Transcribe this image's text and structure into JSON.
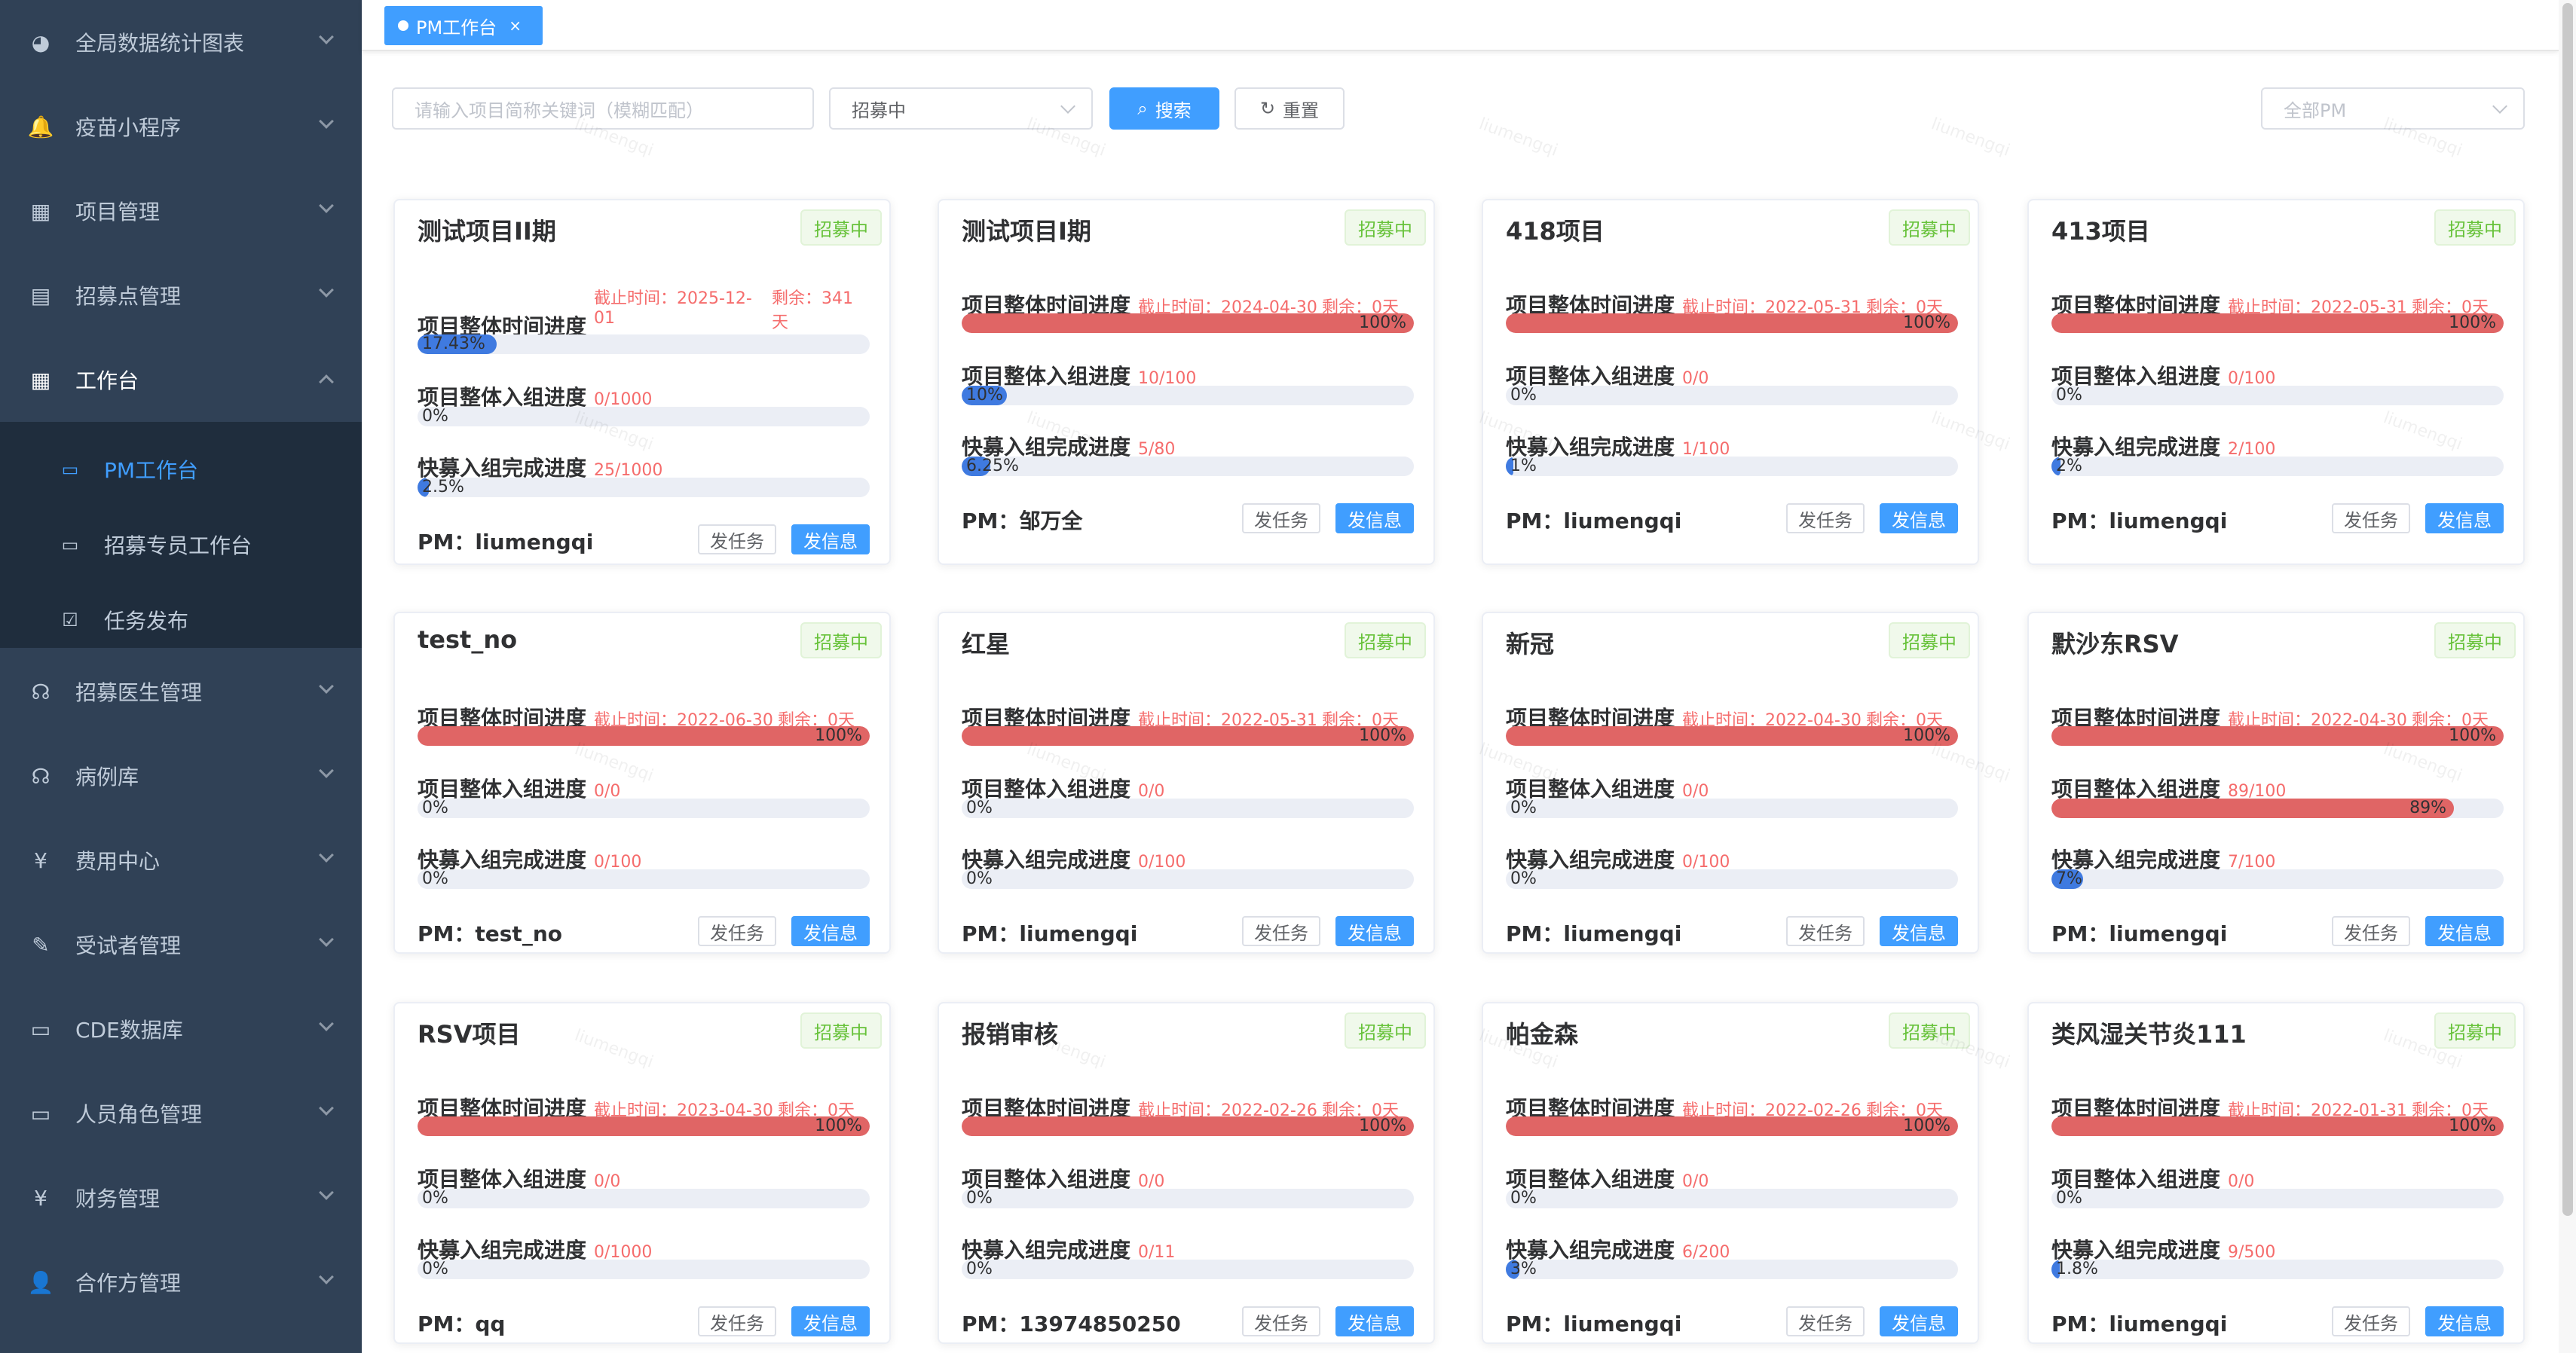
{
  "sidebar": {
    "items": [
      {
        "label": "全局数据统计图表",
        "icon": "dashboard-icon",
        "glyph": "◕"
      },
      {
        "label": "疫苗小程序",
        "icon": "bell-icon",
        "glyph": "🔔"
      },
      {
        "label": "项目管理",
        "icon": "grid-icon",
        "glyph": "▦"
      },
      {
        "label": "招募点管理",
        "icon": "table-icon",
        "glyph": "▤"
      },
      {
        "label": "工作台",
        "icon": "workbench-icon",
        "glyph": "▦"
      },
      {
        "label": "招募医生管理",
        "icon": "doctor-icon",
        "glyph": "☊"
      },
      {
        "label": "病例库",
        "icon": "case-icon",
        "glyph": "☊"
      },
      {
        "label": "费用中心",
        "icon": "yen-icon",
        "glyph": "¥"
      },
      {
        "label": "受试者管理",
        "icon": "subject-icon",
        "glyph": "✎"
      },
      {
        "label": "CDE数据库",
        "icon": "database-icon",
        "glyph": "▭"
      },
      {
        "label": "人员角色管理",
        "icon": "role-icon",
        "glyph": "▭"
      },
      {
        "label": "财务管理",
        "icon": "finance-icon",
        "glyph": "¥"
      },
      {
        "label": "合作方管理",
        "icon": "partner-icon",
        "glyph": "👤"
      }
    ],
    "submenu": [
      {
        "label": "PM工作台",
        "icon": "monitor-icon",
        "glyph": "▭"
      },
      {
        "label": "招募专员工作台",
        "icon": "monitor-icon",
        "glyph": "▭"
      },
      {
        "label": "任务发布",
        "icon": "checkbox-icon",
        "glyph": "☑"
      }
    ]
  },
  "tags": {
    "active_label": "PM工作台",
    "close_glyph": "×"
  },
  "filters": {
    "keyword_placeholder": "请输入项目简称关键词（模糊匹配）",
    "status_value": "招募中",
    "search_label": "搜索",
    "reset_label": "重置",
    "pm_placeholder": "全部PM"
  },
  "watermark": "liumengqi",
  "labels": {
    "time_progress": "项目整体时间进度",
    "enroll_progress": "项目整体入组进度",
    "quick_progress": "快募入组完成进度",
    "pm_prefix": "PM：",
    "task_button": "发任务",
    "msg_button": "发信息",
    "status": "招募中"
  },
  "colors": {
    "accent": "#409eff",
    "progress_red": "#e06565",
    "progress_blue": "#3f7ae0",
    "status_green": "#67c23a",
    "sidebar_bg": "#304156"
  },
  "projects": [
    {
      "name": "测试项目II期",
      "deadline": "截止时间：2025-12-01",
      "remaining": "剩余：341天",
      "deadline_line1": "截止时间：2025-12-",
      "deadline_line2": "01",
      "remaining_line1": "剩余：341",
      "remaining_line2": "天",
      "time_pct": 17.43,
      "time_text": "17.43%",
      "enroll": "0/1000",
      "enroll_pct": 0,
      "enroll_text": "0%",
      "quick": "25/1000",
      "quick_pct": 2.5,
      "quick_text": "2.5%",
      "pm": "liumengqi"
    },
    {
      "name": "测试项目I期",
      "deadline": "截止时间：2024-04-30",
      "remaining": "剩余：0天",
      "time_pct": 100,
      "time_text": "100%",
      "enroll": "10/100",
      "enroll_pct": 10,
      "enroll_text": "10%",
      "quick": "5/80",
      "quick_pct": 6.25,
      "quick_text": "6.25%",
      "pm": "邹万全"
    },
    {
      "name": "418项目",
      "deadline": "截止时间：2022-05-31",
      "remaining": "剩余：0天",
      "time_pct": 100,
      "time_text": "100%",
      "enroll": "0/0",
      "enroll_pct": 0,
      "enroll_text": "0%",
      "quick": "1/100",
      "quick_pct": 1,
      "quick_text": "1%",
      "pm": "liumengqi"
    },
    {
      "name": "413项目",
      "deadline": "截止时间：2022-05-31",
      "remaining": "剩余：0天",
      "time_pct": 100,
      "time_text": "100%",
      "enroll": "0/100",
      "enroll_pct": 0,
      "enroll_text": "0%",
      "quick": "2/100",
      "quick_pct": 2,
      "quick_text": "2%",
      "pm": "liumengqi"
    },
    {
      "name": "test_no",
      "deadline": "截止时间：2022-06-30",
      "remaining": "剩余：0天",
      "time_pct": 100,
      "time_text": "100%",
      "enroll": "0/0",
      "enroll_pct": 0,
      "enroll_text": "0%",
      "quick": "0/100",
      "quick_pct": 0,
      "quick_text": "0%",
      "pm": "test_no"
    },
    {
      "name": "红星",
      "deadline": "截止时间：2022-05-31",
      "remaining": "剩余：0天",
      "time_pct": 100,
      "time_text": "100%",
      "enroll": "0/0",
      "enroll_pct": 0,
      "enroll_text": "0%",
      "quick": "0/100",
      "quick_pct": 0,
      "quick_text": "0%",
      "pm": "liumengqi"
    },
    {
      "name": "新冠",
      "deadline": "截止时间：2022-04-30",
      "remaining": "剩余：0天",
      "time_pct": 100,
      "time_text": "100%",
      "enroll": "0/0",
      "enroll_pct": 0,
      "enroll_text": "0%",
      "quick": "0/100",
      "quick_pct": 0,
      "quick_text": "0%",
      "pm": "liumengqi"
    },
    {
      "name": "默沙东RSV",
      "deadline": "截止时间：2022-04-30",
      "remaining": "剩余：0天",
      "time_pct": 100,
      "time_text": "100%",
      "enroll": "89/100",
      "enroll_pct": 89,
      "enroll_text": "89%",
      "quick": "7/100",
      "quick_pct": 7,
      "quick_text": "7%",
      "pm": "liumengqi"
    },
    {
      "name": "RSV项目",
      "deadline": "截止时间：2023-04-30",
      "remaining": "剩余：0天",
      "time_pct": 100,
      "time_text": "100%",
      "enroll": "0/0",
      "enroll_pct": 0,
      "enroll_text": "0%",
      "quick": "0/1000",
      "quick_pct": 0,
      "quick_text": "0%",
      "pm": "qq"
    },
    {
      "name": "报销审核",
      "deadline": "截止时间：2022-02-26",
      "remaining": "剩余：0天",
      "time_pct": 100,
      "time_text": "100%",
      "enroll": "0/0",
      "enroll_pct": 0,
      "enroll_text": "0%",
      "quick": "0/11",
      "quick_pct": 0,
      "quick_text": "0%",
      "pm": "13974850250"
    },
    {
      "name": "帕金森",
      "deadline": "截止时间：2022-02-26",
      "remaining": "剩余：0天",
      "time_pct": 100,
      "time_text": "100%",
      "enroll": "0/0",
      "enroll_pct": 0,
      "enroll_text": "0%",
      "quick": "6/200",
      "quick_pct": 3,
      "quick_text": "3%",
      "pm": "liumengqi"
    },
    {
      "name": "类风湿关节炎111",
      "deadline": "截止时间：2022-01-31",
      "remaining": "剩余：0天",
      "time_pct": 100,
      "time_text": "100%",
      "enroll": "0/0",
      "enroll_pct": 0,
      "enroll_text": "0%",
      "quick": "9/500",
      "quick_pct": 1.8,
      "quick_text": "1.8%",
      "pm": "liumengqi"
    }
  ]
}
